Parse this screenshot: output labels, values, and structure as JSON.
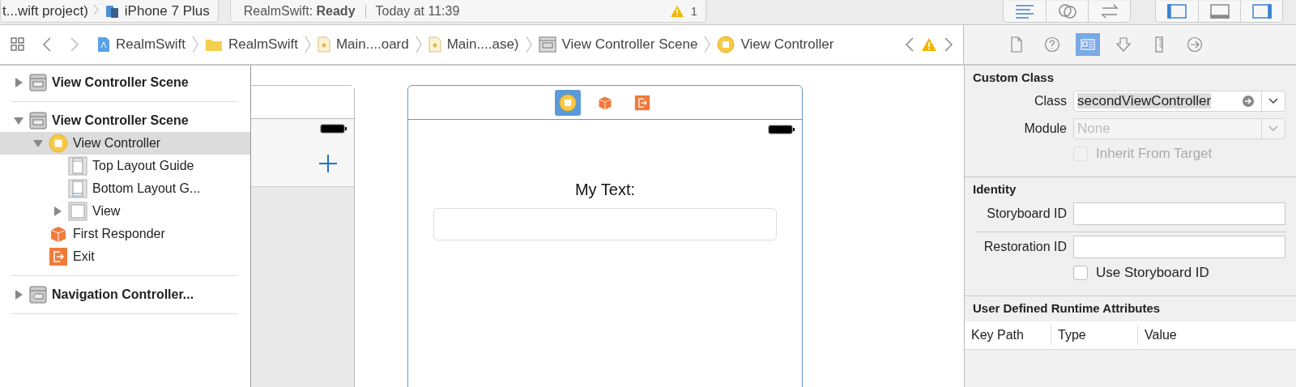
{
  "toolbar": {
    "scheme": {
      "project": "t...wift project)",
      "device": "iPhone 7 Plus"
    },
    "status": {
      "project": "RealmSwift:",
      "state": "Ready",
      "time": "Today at 11:39",
      "warnings": "1"
    },
    "editor_modes": [
      {
        "kind": "standard",
        "selected": true
      },
      {
        "kind": "assistant",
        "selected": false
      },
      {
        "kind": "version",
        "selected": false
      }
    ],
    "panels": [
      {
        "kind": "navigator",
        "on": true
      },
      {
        "kind": "debug",
        "on": false
      },
      {
        "kind": "utilities",
        "on": true
      }
    ]
  },
  "jump_bar": {
    "items": [
      {
        "kind": "project",
        "label": "RealmSwift"
      },
      {
        "kind": "folder",
        "label": "RealmSwift"
      },
      {
        "kind": "storyboard",
        "label": "Main....oard"
      },
      {
        "kind": "storyboard",
        "label": "Main....ase)"
      },
      {
        "kind": "scene",
        "label": "View Controller Scene"
      },
      {
        "kind": "controller",
        "label": "View Controller"
      }
    ]
  },
  "inspector_tabs": [
    {
      "kind": "file",
      "selected": false
    },
    {
      "kind": "help",
      "selected": false
    },
    {
      "kind": "identity",
      "selected": true
    },
    {
      "kind": "attributes",
      "selected": false
    },
    {
      "kind": "size",
      "selected": false
    },
    {
      "kind": "connections",
      "selected": false
    }
  ],
  "outline": [
    {
      "kind": "scene",
      "label": "View Controller Scene",
      "expanded": false,
      "selected": false
    },
    {
      "kind": "scene",
      "label": "View Controller Scene",
      "expanded": true,
      "selected": false,
      "children": [
        {
          "kind": "controller",
          "label": "View Controller",
          "expanded": true,
          "selected": true,
          "children": [
            {
              "kind": "top_guide",
              "label": "Top Layout Guide",
              "selected": false
            },
            {
              "kind": "bottom_guide",
              "label": "Bottom Layout G...",
              "selected": false
            },
            {
              "kind": "view",
              "label": "View",
              "expanded": false,
              "selected": false
            }
          ]
        },
        {
          "kind": "responder",
          "label": "First Responder",
          "selected": false
        },
        {
          "kind": "exit",
          "label": "Exit",
          "selected": false
        }
      ]
    },
    {
      "kind": "nav_scene",
      "label": "Navigation Controller...",
      "expanded": false,
      "selected": false
    }
  ],
  "canvas": {
    "scene": {
      "dock": [
        {
          "kind": "controller",
          "selected": true
        },
        {
          "kind": "responder",
          "selected": false
        },
        {
          "kind": "exit",
          "selected": false
        }
      ],
      "label": "My Text:"
    }
  },
  "inspector": {
    "custom_class": {
      "title": "Custom Class",
      "class_label": "Class",
      "class_value": "secondViewController",
      "module_label": "Module",
      "module_placeholder": "None",
      "inherit": {
        "label": "Inherit From Target",
        "checked": false,
        "disabled": true
      }
    },
    "identity": {
      "title": "Identity",
      "storyboard_label": "Storyboard ID",
      "restoration_label": "Restoration ID",
      "use_storyboard": {
        "label": "Use Storyboard ID",
        "checked": false,
        "disabled": false
      }
    },
    "runtime_attributes": {
      "title": "User Defined Runtime Attributes",
      "columns": [
        "Key Path",
        "Type",
        "Value"
      ]
    }
  }
}
